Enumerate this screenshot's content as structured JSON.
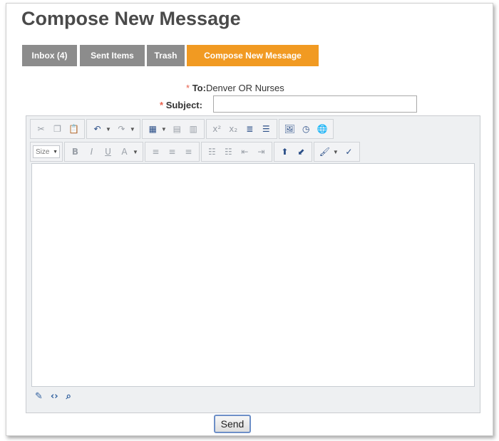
{
  "page": {
    "title": "Compose New Message"
  },
  "tabs": [
    {
      "label": "Inbox (4)",
      "active": false
    },
    {
      "label": "Sent Items",
      "active": false
    },
    {
      "label": "Trash",
      "active": false
    },
    {
      "label": "Compose New Message",
      "active": true
    }
  ],
  "form": {
    "to_required": "*",
    "to_label": "To:",
    "to_value": "Denver OR Nurses",
    "subject_required": "*",
    "subject_label": "Subject:",
    "subject_value": ""
  },
  "toolbar": {
    "size_label": "Size",
    "row1_icons": [
      "cut-icon",
      "copy-icon",
      "paste-icon",
      "undo-icon",
      "redo-icon",
      "table-icon",
      "merge-cells-icon",
      "split-cells-icon",
      "superscript-icon",
      "subscript-icon",
      "indent-paragraph-icon",
      "horizontal-rule-icon",
      "image-icon",
      "clock-icon",
      "hyperlink-icon"
    ],
    "row2_icons": [
      "bold-icon",
      "italic-icon",
      "underline-icon",
      "font-color-icon",
      "align-left-icon",
      "align-center-icon",
      "align-right-icon",
      "ordered-list-icon",
      "unordered-list-icon",
      "outdent-icon",
      "indent-icon",
      "insert-link-icon",
      "remove-link-icon",
      "format-brush-icon",
      "spellcheck-icon"
    ]
  },
  "modes": [
    "design-mode-icon",
    "html-mode-icon",
    "preview-mode-icon"
  ],
  "actions": {
    "send_label": "Send"
  },
  "colors": {
    "tab_active": "#f19a22",
    "tab_inactive": "#8c8c8c",
    "required": "#e8604c",
    "title": "#4a4a4a"
  }
}
